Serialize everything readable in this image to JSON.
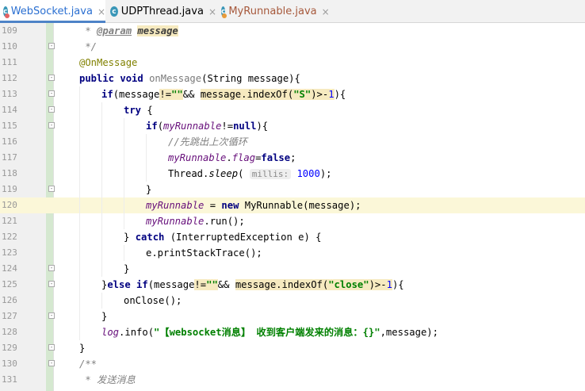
{
  "tabs": [
    {
      "label": "WebSocket.java",
      "icon": "class-icon",
      "badge_color": "#e36262",
      "active": true
    },
    {
      "label": "UDPThread.java",
      "icon": "class-icon",
      "badge_color": "",
      "active": false
    },
    {
      "label": "MyRunnable.java",
      "icon": "class-icon",
      "badge_color": "#e89b3b",
      "active": false
    }
  ],
  "tab_close": "×",
  "editor": {
    "current_line": "120",
    "lines": [
      {
        "n": "109",
        "fold": "",
        "indent": 0,
        "tokens": [
          {
            "t": " * ",
            "c": "cmt"
          },
          {
            "t": "@param",
            "c": "dparam"
          },
          {
            "t": " ",
            "c": "cmt"
          },
          {
            "t": "message",
            "c": "dname"
          }
        ]
      },
      {
        "n": "110",
        "fold": "-",
        "indent": 0,
        "tokens": [
          {
            "t": " */",
            "c": "cmt"
          }
        ]
      },
      {
        "n": "111",
        "fold": "",
        "indent": 0,
        "tokens": [
          {
            "t": "@OnMessage",
            "c": "anno"
          }
        ]
      },
      {
        "n": "112",
        "fold": "-",
        "indent": 0,
        "tokens": [
          {
            "t": "public ",
            "c": "kw"
          },
          {
            "t": "void ",
            "c": "kw"
          },
          {
            "t": "onMessage",
            "c": "mref"
          },
          {
            "t": "(String message){",
            "c": ""
          }
        ]
      },
      {
        "n": "113",
        "fold": "-",
        "indent": 1,
        "tokens": [
          {
            "t": "if",
            "c": "kw"
          },
          {
            "t": "(message",
            "c": ""
          },
          {
            "t": "!=",
            "c": "hl"
          },
          {
            "t": "\"\"",
            "c": "str hl"
          },
          {
            "t": "&& ",
            "c": ""
          },
          {
            "t": "message.indexOf(",
            "c": "hl"
          },
          {
            "t": "\"S\"",
            "c": "str hl"
          },
          {
            "t": ")>-",
            "c": "hl"
          },
          {
            "t": "1",
            "c": "num hl"
          },
          {
            "t": "){",
            "c": ""
          }
        ]
      },
      {
        "n": "114",
        "fold": "-",
        "indent": 2,
        "tokens": [
          {
            "t": "try ",
            "c": "kw"
          },
          {
            "t": "{",
            "c": ""
          }
        ]
      },
      {
        "n": "115",
        "fold": "-",
        "indent": 3,
        "tokens": [
          {
            "t": "if",
            "c": "kw"
          },
          {
            "t": "(",
            "c": ""
          },
          {
            "t": "myRunnable",
            "c": "fld"
          },
          {
            "t": "!=",
            "c": ""
          },
          {
            "t": "null",
            "c": "kw"
          },
          {
            "t": "){",
            "c": ""
          }
        ]
      },
      {
        "n": "116",
        "fold": "",
        "indent": 4,
        "tokens": [
          {
            "t": "//先跳出上次循环",
            "c": "cmt"
          }
        ]
      },
      {
        "n": "117",
        "fold": "",
        "indent": 4,
        "tokens": [
          {
            "t": "myRunnable",
            "c": "fld"
          },
          {
            "t": ".",
            "c": ""
          },
          {
            "t": "flag",
            "c": "fld"
          },
          {
            "t": "=",
            "c": ""
          },
          {
            "t": "false",
            "c": "kw"
          },
          {
            "t": ";",
            "c": ""
          }
        ]
      },
      {
        "n": "118",
        "fold": "",
        "indent": 4,
        "tokens": [
          {
            "t": "Thread.",
            "c": ""
          },
          {
            "t": "sleep",
            "c": "stat"
          },
          {
            "t": "( ",
            "c": ""
          },
          {
            "t": "millis:",
            "c": "hint"
          },
          {
            "t": " ",
            "c": ""
          },
          {
            "t": "1000",
            "c": "num"
          },
          {
            "t": ");",
            "c": ""
          }
        ]
      },
      {
        "n": "119",
        "fold": "-",
        "indent": 3,
        "tokens": [
          {
            "t": "}",
            "c": ""
          }
        ]
      },
      {
        "n": "120",
        "fold": "",
        "indent": 3,
        "tokens": [
          {
            "t": "myRunnable",
            "c": "fld"
          },
          {
            "t": " = ",
            "c": ""
          },
          {
            "t": "new ",
            "c": "kw"
          },
          {
            "t": "MyRunnable(message);",
            "c": ""
          }
        ]
      },
      {
        "n": "121",
        "fold": "",
        "indent": 3,
        "tokens": [
          {
            "t": "myRunnable",
            "c": "fld"
          },
          {
            "t": ".run();",
            "c": ""
          }
        ]
      },
      {
        "n": "122",
        "fold": "",
        "indent": 2,
        "tokens": [
          {
            "t": "} ",
            "c": ""
          },
          {
            "t": "catch ",
            "c": "kw"
          },
          {
            "t": "(InterruptedException e) {",
            "c": ""
          }
        ]
      },
      {
        "n": "123",
        "fold": "",
        "indent": 3,
        "tokens": [
          {
            "t": "e.printStackTrace();",
            "c": ""
          }
        ]
      },
      {
        "n": "124",
        "fold": "-",
        "indent": 2,
        "tokens": [
          {
            "t": "}",
            "c": ""
          }
        ]
      },
      {
        "n": "125",
        "fold": "-",
        "indent": 1,
        "tokens": [
          {
            "t": "}",
            "c": ""
          },
          {
            "t": "else if",
            "c": "kw"
          },
          {
            "t": "(message",
            "c": ""
          },
          {
            "t": "!=",
            "c": "hl"
          },
          {
            "t": "\"\"",
            "c": "str hl"
          },
          {
            "t": "&& ",
            "c": ""
          },
          {
            "t": "message.indexOf(",
            "c": "hl"
          },
          {
            "t": "\"close\"",
            "c": "str hl"
          },
          {
            "t": ")>-",
            "c": "hl"
          },
          {
            "t": "1",
            "c": "num hl"
          },
          {
            "t": "){",
            "c": ""
          }
        ]
      },
      {
        "n": "126",
        "fold": "",
        "indent": 2,
        "tokens": [
          {
            "t": "onClose();",
            "c": ""
          }
        ]
      },
      {
        "n": "127",
        "fold": "-",
        "indent": 1,
        "tokens": [
          {
            "t": "}",
            "c": ""
          }
        ]
      },
      {
        "n": "128",
        "fold": "",
        "indent": 1,
        "tokens": [
          {
            "t": "log",
            "c": "fld"
          },
          {
            "t": ".info(",
            "c": ""
          },
          {
            "t": "\"【websocket消息】 收到客户端发来的消息：{}\"",
            "c": "str"
          },
          {
            "t": ",message);",
            "c": ""
          }
        ]
      },
      {
        "n": "129",
        "fold": "-",
        "indent": 0,
        "tokens": [
          {
            "t": "}",
            "c": ""
          }
        ]
      },
      {
        "n": "130",
        "fold": "-",
        "indent": 0,
        "tokens": [
          {
            "t": "/**",
            "c": "cmt"
          }
        ]
      },
      {
        "n": "131",
        "fold": "",
        "indent": 0,
        "tokens": [
          {
            "t": " * 发送消息",
            "c": "cmt"
          }
        ]
      }
    ]
  }
}
